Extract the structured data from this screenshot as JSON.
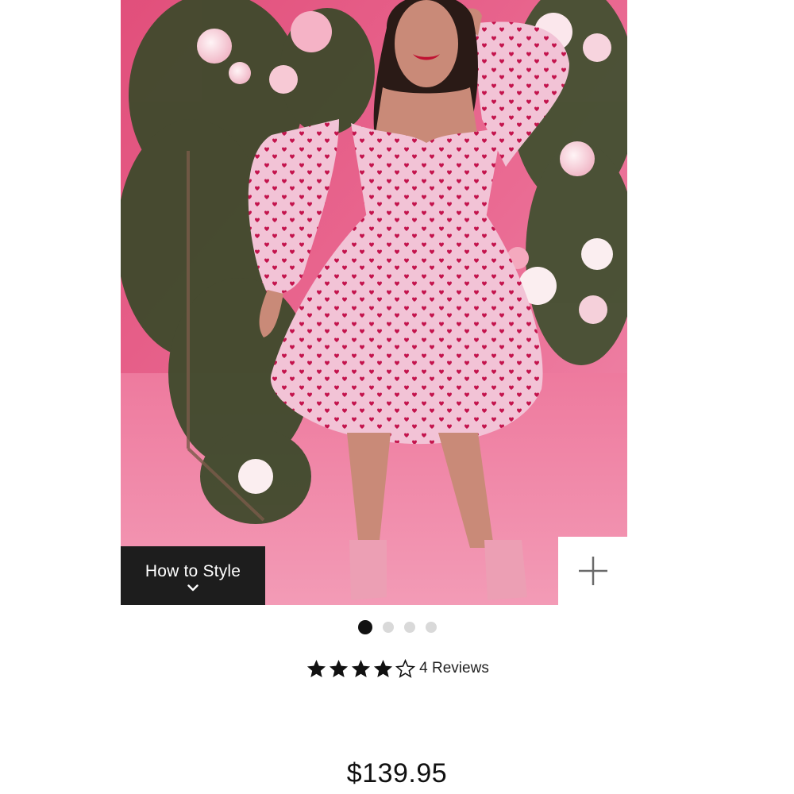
{
  "product": {
    "image_alt": "Pink heart-print puff sleeve dress",
    "how_to_style_label": "How to Style",
    "add_icon": "plus-icon",
    "carousel": {
      "total": 4,
      "active_index": 0
    },
    "rating": {
      "value": 4,
      "max": 5,
      "reviews_label": "4 Reviews"
    },
    "price": "$139.95"
  },
  "colors": {
    "background_pink": "#e35c86",
    "dress_pink": "#f2c3d6",
    "heart_red": "#c3134c",
    "banner_dark": "#1d1d1d"
  }
}
